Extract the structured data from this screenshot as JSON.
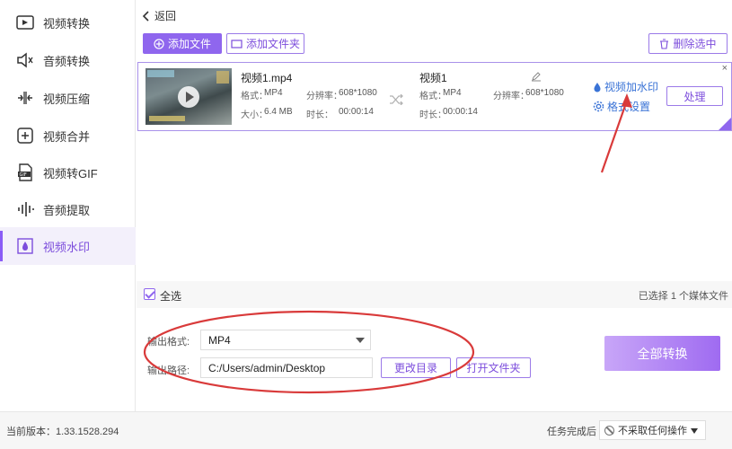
{
  "sidebar": {
    "items": [
      {
        "label": "视频转换",
        "icon": "video-convert-icon"
      },
      {
        "label": "音频转换",
        "icon": "audio-convert-icon"
      },
      {
        "label": "视频压缩",
        "icon": "compress-icon"
      },
      {
        "label": "视频合并",
        "icon": "merge-icon"
      },
      {
        "label": "视频转GIF",
        "icon": "gif-icon"
      },
      {
        "label": "音频提取",
        "icon": "audio-extract-icon"
      },
      {
        "label": "视频水印",
        "icon": "watermark-icon"
      }
    ],
    "active_index": 6
  },
  "header": {
    "back_label": "返回"
  },
  "toolbar": {
    "add_file_label": "添加文件",
    "add_folder_label": "添加文件夹",
    "delete_selected_label": "删除选中"
  },
  "file": {
    "source_name": "视频1.mp4",
    "source_format_label": "格式：",
    "source_format": "MP4",
    "source_resolution_label": "分辨率：",
    "source_resolution": "608*1080",
    "source_size_label": "大小：",
    "source_size": "6.4 MB",
    "source_duration_label": "时长：",
    "source_duration": "00:00:14",
    "output_name": "视频1",
    "output_format_label": "格式：",
    "output_format": "MP4",
    "output_resolution_label": "分辨率：",
    "output_resolution": "608*1080",
    "output_duration_label": "时长：",
    "output_duration": "00:00:14",
    "watermark_link": "视频加水印",
    "format_settings_link": "格式设置",
    "process_label": "处理",
    "close_glyph": "×"
  },
  "selection": {
    "select_all_label": "全选",
    "selected_count_text": "已选择 1 个媒体文件"
  },
  "output": {
    "format_label": "输出格式:",
    "format_value": "MP4",
    "path_label": "输出路径:",
    "path_value": "C:/Users/admin/Desktop",
    "change_dir_label": "更改目录",
    "open_folder_label": "打开文件夹",
    "convert_all_label": "全部转换"
  },
  "status": {
    "version_text": "当前版本：1.33.1528.294",
    "after_complete_label": "任务完成后",
    "after_complete_value": "不采取任何操作"
  },
  "colors": {
    "accent": "#8f66ee",
    "annotation": "#d93a3a",
    "link": "#3a73d6"
  }
}
